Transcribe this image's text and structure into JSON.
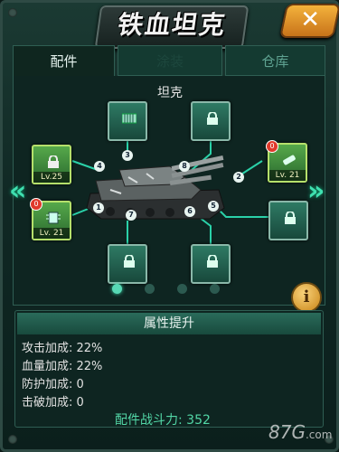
{
  "title": "铁血坦克",
  "close_label": "✕",
  "tabs": [
    {
      "label": "配件",
      "active": true
    },
    {
      "label": "涂装",
      "active": false
    },
    {
      "label": "仓库",
      "active": false
    }
  ],
  "section_title": "坦克",
  "slots": [
    {
      "id": "1",
      "level": "Lv. 21",
      "badge": "0",
      "locked": false,
      "icon": "chip-icon"
    },
    {
      "id": "2",
      "level": "Lv. 21",
      "badge": "0",
      "locked": false,
      "icon": "battery-icon"
    },
    {
      "id": "3",
      "level": "",
      "badge": "",
      "locked": false,
      "icon": "armor-icon"
    },
    {
      "id": "4",
      "level": "Lv.25",
      "badge": "",
      "locked": true,
      "icon": "lock-icon"
    },
    {
      "id": "5",
      "level": "",
      "badge": "",
      "locked": true,
      "icon": "lock-icon"
    },
    {
      "id": "6",
      "level": "",
      "badge": "",
      "locked": true,
      "icon": "lock-icon"
    },
    {
      "id": "7",
      "level": "",
      "badge": "",
      "locked": true,
      "icon": "lock-icon"
    },
    {
      "id": "8",
      "level": "",
      "badge": "",
      "locked": true,
      "icon": "lock-icon"
    }
  ],
  "page_dots": {
    "count": 4,
    "active_index": 0
  },
  "info_label": "i",
  "attributes": {
    "title": "属性提升",
    "rows": [
      "攻击加成: 22%",
      "血量加成: 22%",
      "防护加成: 0",
      "击破加成: 0"
    ],
    "power": "配件战斗力: 352"
  },
  "watermark": {
    "brand": "87G",
    "suffix": ".com"
  },
  "colors": {
    "accent": "#3fe0b0",
    "panel": "#0e2521",
    "close": "#f3b23b"
  }
}
